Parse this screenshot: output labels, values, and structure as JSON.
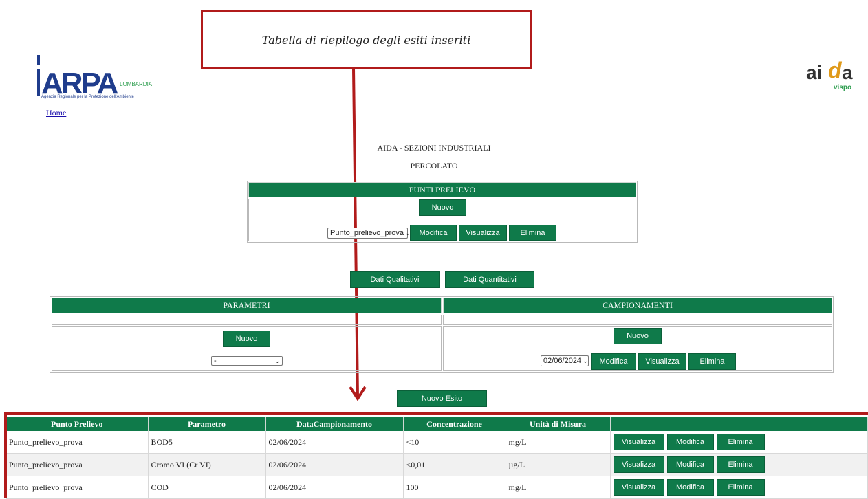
{
  "annotation": {
    "callout_text": "Tabella di riepilogo degli esiti inseriti"
  },
  "logo_left": {
    "mark": "ARPA",
    "sub": "LOMBARDIA",
    "tagline": "Agenzia Regionale per la Protezione dell'Ambiente"
  },
  "logo_right": {
    "part1": "ai",
    "part2": "d",
    "part3": "a",
    "sub": "vispo"
  },
  "nav": {
    "home_link": "Home"
  },
  "page": {
    "title": "AIDA - SEZIONI INDUSTRIALI",
    "subtitle": "PERCOLATO"
  },
  "punti_prelievo": {
    "header": "PUNTI PRELIEVO",
    "new_label": "Nuovo",
    "selected": "Punto_prelievo_prova",
    "edit_label": "Modifica",
    "view_label": "Visualizza",
    "delete_label": "Elimina"
  },
  "tabs": {
    "qualitativi": "Dati Qualitativi",
    "quantitativi": "Dati Quantitativi"
  },
  "parametri": {
    "header": "PARAMETRI",
    "new_label": "Nuovo",
    "selected": "-"
  },
  "campionamenti": {
    "header": "CAMPIONAMENTI",
    "new_label": "Nuovo",
    "selected": "02/06/2024",
    "edit_label": "Modifica",
    "view_label": "Visualizza",
    "delete_label": "Elimina"
  },
  "nuovo_esito": "Nuovo Esito",
  "results": {
    "columns": [
      "Punto Prelievo",
      "Parametro",
      "DataCampionamento",
      "Concentrazione",
      "Unità di Misura",
      ""
    ],
    "rows": [
      {
        "punto": "Punto_prelievo_prova",
        "parametro": "BOD5",
        "data": "02/06/2024",
        "conc": "<10",
        "unita": "mg/L"
      },
      {
        "punto": "Punto_prelievo_prova",
        "parametro": "Cromo VI (Cr VI)",
        "data": "02/06/2024",
        "conc": "<0,01",
        "unita": "µg/L"
      },
      {
        "punto": "Punto_prelievo_prova",
        "parametro": "COD",
        "data": "02/06/2024",
        "conc": "100",
        "unita": "mg/L"
      }
    ],
    "row_actions": {
      "view": "Visualizza",
      "edit": "Modifica",
      "delete": "Elimina"
    }
  },
  "colors": {
    "primary_green": "#0f7a4a",
    "annotation_red": "#b11b1b",
    "logo_blue": "#1f3c8c",
    "logo_green": "#2e9e4f"
  }
}
